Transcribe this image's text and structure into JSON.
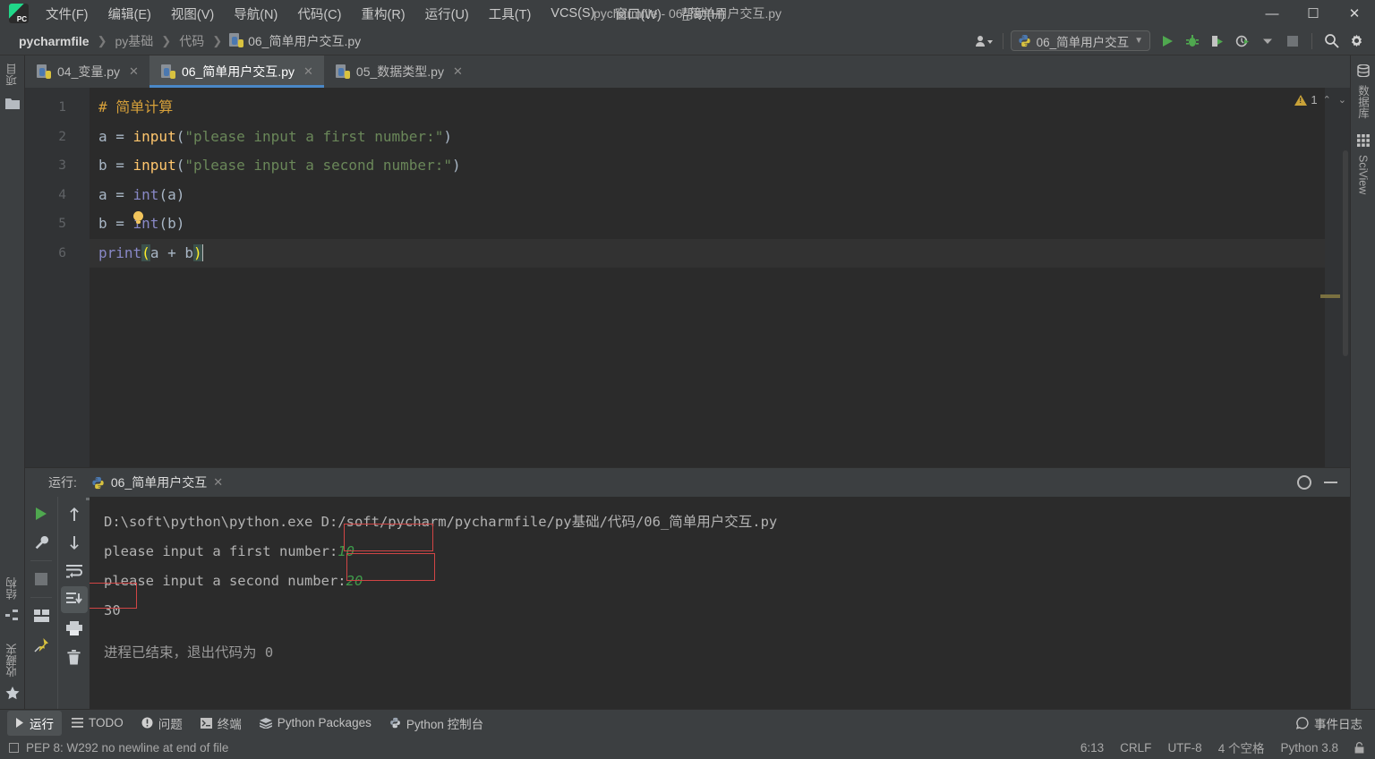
{
  "window": {
    "title": "pycharmfile - 06_简单用户交互.py",
    "minimize": "—",
    "maximize": "☐",
    "close": "✕"
  },
  "menu": {
    "items": [
      {
        "label": "文件(F)"
      },
      {
        "label": "编辑(E)"
      },
      {
        "label": "视图(V)"
      },
      {
        "label": "导航(N)"
      },
      {
        "label": "代码(C)"
      },
      {
        "label": "重构(R)"
      },
      {
        "label": "运行(U)"
      },
      {
        "label": "工具(T)"
      },
      {
        "label": "VCS(S)"
      },
      {
        "label": "窗口(W)"
      },
      {
        "label": "帮助(H)"
      }
    ]
  },
  "breadcrumb": {
    "root": "pycharmfile",
    "sep": "❯",
    "items": [
      {
        "label": "py基础"
      },
      {
        "label": "代码"
      }
    ],
    "file": "06_简单用户交互.py"
  },
  "run_config": {
    "name": "06_简单用户交互",
    "chevron": "▼"
  },
  "editor_tabs": [
    {
      "label": "04_变量.py",
      "active": false,
      "close": "✕"
    },
    {
      "label": "06_简单用户交互.py",
      "active": true,
      "close": "✕"
    },
    {
      "label": "05_数据类型.py",
      "active": false,
      "close": "✕"
    }
  ],
  "editor": {
    "line_numbers": [
      "1",
      "2",
      "3",
      "4",
      "5",
      "6"
    ],
    "warning_count": "1",
    "chevron_up": "⌃",
    "chevron_down": "⌄",
    "code": {
      "l1_comment": "# 简单计算",
      "l2_var": "a = ",
      "l2_fn": "input",
      "l2_open": "(",
      "l2_str": "\"please input a first number:\"",
      "l2_close": ")",
      "l3_var": "b = ",
      "l3_fn": "input",
      "l3_open": "(",
      "l3_str": "\"please input a second number:\"",
      "l3_close": ")",
      "l4_var": "a = ",
      "l4_fn": "int",
      "l4_rest": "(a)",
      "l5_var": "b = ",
      "l5_fn": "int",
      "l5_rest": "(b)",
      "l6_fn": "print",
      "l6_open": "(",
      "l6_mid": "a + b",
      "l6_close": ")"
    }
  },
  "left_bar": {
    "project": "项目",
    "structure": "结构",
    "favorites": "收藏夹"
  },
  "right_bar": {
    "database": "数据库",
    "sciview": "SciView"
  },
  "run_panel": {
    "label": "运行:",
    "tab": "06_简单用户交互",
    "close": "✕",
    "console": {
      "command": "D:\\soft\\python\\python.exe D:/soft/pycharm/pycharmfile/py基础/代码/06_简单用户交互.py",
      "prompt1": "please input a first number:",
      "input1": "10",
      "prompt2": "please input a second number:",
      "input2": "20",
      "result": "30",
      "exit": "进程已结束，退出代码为 0"
    }
  },
  "tool_windows": [
    {
      "label": "运行",
      "icon": "play-icon",
      "active": true
    },
    {
      "label": "TODO",
      "icon": "list-icon",
      "active": false
    },
    {
      "label": "问题",
      "icon": "error-icon",
      "active": false
    },
    {
      "label": "终端",
      "icon": "terminal-icon",
      "active": false
    },
    {
      "label": "Python Packages",
      "icon": "packages-icon",
      "active": false
    },
    {
      "label": "Python 控制台",
      "icon": "python-icon",
      "active": false
    }
  ],
  "event_log": {
    "label": "事件日志"
  },
  "status_bar": {
    "inspection": "PEP 8: W292 no newline at end of file",
    "caret": "6:13",
    "line_sep": "CRLF",
    "encoding": "UTF-8",
    "indent": "4 个空格",
    "interpreter": "Python 3.8"
  },
  "colors": {
    "accent_blue": "#4a88c7",
    "run_green": "#4fa84f",
    "annotation_red": "#d14545",
    "comment_orange": "#d6a03a",
    "string_green": "#6a8759",
    "function_yellow": "#ffc66d",
    "builtin_purple": "#8888c6",
    "editor_bg": "#2b2b2b",
    "chrome_bg": "#3c3f41"
  }
}
